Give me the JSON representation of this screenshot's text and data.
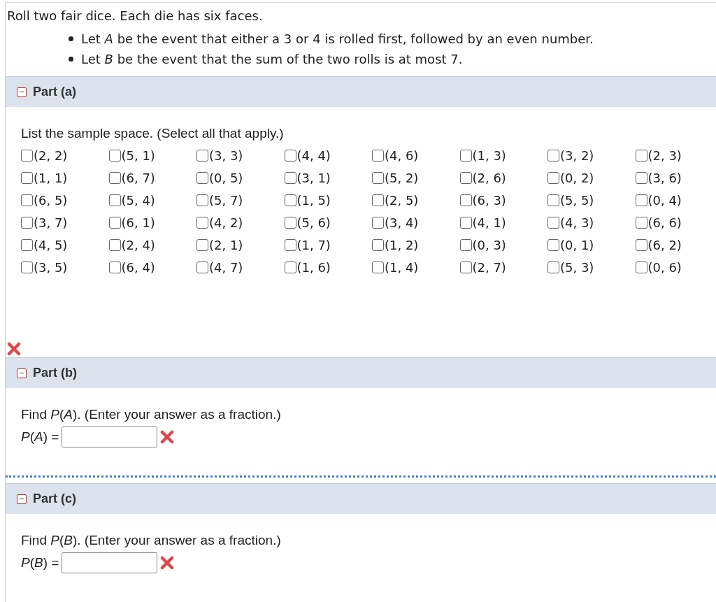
{
  "intro": "Roll two fair dice. Each die has six faces.",
  "bullets": [
    "Let *A* be the event that either a 3 or 4 is rolled first, followed by an even number.",
    "Let *B* be the event that the sum of the two rolls is at most 7."
  ],
  "parts": [
    {
      "label": "Part (a)",
      "expanded": true,
      "kind": "choices",
      "prompt": "List the sample space. (Select all that apply.)",
      "incorrect": true,
      "options": [
        {
          "label": "(2, 2)",
          "checked": false
        },
        {
          "label": "(5, 1)",
          "checked": false
        },
        {
          "label": "(3, 3)",
          "checked": false
        },
        {
          "label": "(4, 4)",
          "checked": false
        },
        {
          "label": "(4, 6)",
          "checked": false
        },
        {
          "label": "(1, 3)",
          "checked": false
        },
        {
          "label": "(3, 2)",
          "checked": false
        },
        {
          "label": "(2, 3)",
          "checked": false
        },
        {
          "label": "(1, 1)",
          "checked": false
        },
        {
          "label": "(6, 7)",
          "checked": false
        },
        {
          "label": "(0, 5)",
          "checked": false
        },
        {
          "label": "(3, 1)",
          "checked": false
        },
        {
          "label": "(5, 2)",
          "checked": false
        },
        {
          "label": "(2, 6)",
          "checked": false
        },
        {
          "label": "(0, 2)",
          "checked": false
        },
        {
          "label": "(3, 6)",
          "checked": false
        },
        {
          "label": "(6, 5)",
          "checked": false
        },
        {
          "label": "(5, 4)",
          "checked": false
        },
        {
          "label": "(5, 7)",
          "checked": false
        },
        {
          "label": "(1, 5)",
          "checked": false
        },
        {
          "label": "(2, 5)",
          "checked": false
        },
        {
          "label": "(6, 3)",
          "checked": false
        },
        {
          "label": "(5, 5)",
          "checked": false
        },
        {
          "label": "(0, 4)",
          "checked": false
        },
        {
          "label": "(3, 7)",
          "checked": false
        },
        {
          "label": "(6, 1)",
          "checked": false
        },
        {
          "label": "(4, 2)",
          "checked": false
        },
        {
          "label": "(5, 6)",
          "checked": false
        },
        {
          "label": "(3, 4)",
          "checked": false
        },
        {
          "label": "(4, 1)",
          "checked": false
        },
        {
          "label": "(4, 3)",
          "checked": false
        },
        {
          "label": "(6, 6)",
          "checked": false
        },
        {
          "label": "(4, 5)",
          "checked": false
        },
        {
          "label": "(2, 4)",
          "checked": false
        },
        {
          "label": "(2, 1)",
          "checked": false
        },
        {
          "label": "(1, 7)",
          "checked": false
        },
        {
          "label": "(1, 2)",
          "checked": false
        },
        {
          "label": "(0, 3)",
          "checked": false
        },
        {
          "label": "(0, 1)",
          "checked": false
        },
        {
          "label": "(6, 2)",
          "checked": false
        },
        {
          "label": "(3, 5)",
          "checked": false
        },
        {
          "label": "(6, 4)",
          "checked": false
        },
        {
          "label": "(4, 7)",
          "checked": false
        },
        {
          "label": "(1, 6)",
          "checked": false
        },
        {
          "label": "(1, 4)",
          "checked": false
        },
        {
          "label": "(2, 7)",
          "checked": false
        },
        {
          "label": "(5, 3)",
          "checked": false
        },
        {
          "label": "(0, 6)",
          "checked": false
        }
      ]
    },
    {
      "label": "Part (b)",
      "expanded": true,
      "kind": "fraction",
      "prompt": "Find *P*(*A*). (Enter your answer as a fraction.)",
      "answer_label": "*P*(*A*) =",
      "incorrect": true
    },
    {
      "label": "Part (c)",
      "expanded": true,
      "kind": "fraction",
      "prompt": "Find *P*(*B*). (Enter your answer as a fraction.)",
      "answer_label": "*P*(*B*) =",
      "incorrect": true
    }
  ]
}
